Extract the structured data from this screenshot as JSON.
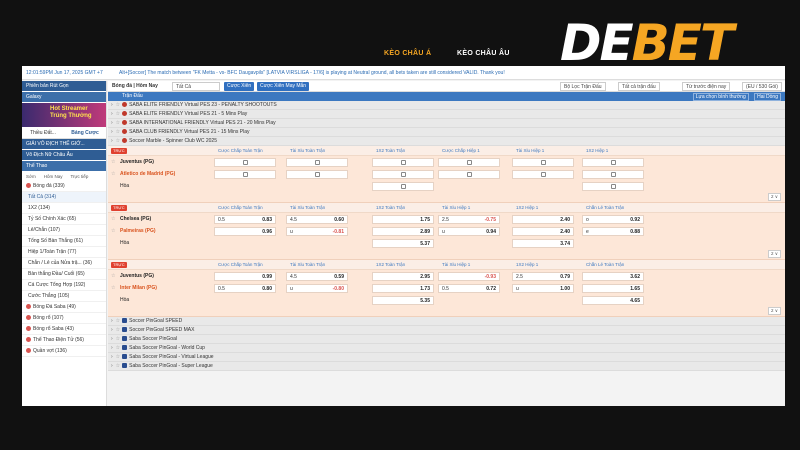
{
  "brand": {
    "logo_de": "DE",
    "logo_bet": "BET"
  },
  "top_tabs": {
    "active": "KÈO CHÂU Á",
    "other": "KÈO CHÂU ÂU"
  },
  "status": {
    "time": "12:01:59PM Jun 17, 2025 GMT +7",
    "message": "Alt+[Soccer] The match between \"FK Metta - vs- BFC Daugavpils\" [LATVIA VIRSLIGA - 17/6] is playing at Neutral ground, all bets taken are still considered VALID. Thank you!"
  },
  "sidebar": {
    "head1": "Phiên bản Rút Gọn",
    "head2": "Galaxy",
    "banner": "Hot Streamer Trúng Thưởng",
    "tabs": [
      "Thiều Đất...",
      "Bảng Cược"
    ],
    "sections": [
      "GIẢI VÔ ĐỊCH THẾ GIỚ...",
      "Vô Địch Nữ Châu Âu",
      "Thể Thao"
    ],
    "subtabs": [
      "Sớm",
      "Hôm Nay",
      "Trực tiếp"
    ],
    "items": [
      {
        "label": "Bóng đá (339)",
        "type": "sport"
      },
      {
        "label": "Tất Cả (314)",
        "type": "sel"
      },
      {
        "label": "1X2 (134)",
        "type": "sub"
      },
      {
        "label": "Tỷ Số Chính Xác (65)",
        "type": "sub"
      },
      {
        "label": "Lẻ/Chẵn (107)",
        "type": "sub"
      },
      {
        "label": "Tổng Số Bàn Thắng (61)",
        "type": "sub"
      },
      {
        "label": "Hiệp 1/Toàn Trận (77)",
        "type": "sub"
      },
      {
        "label": "Chẵn / Lẻ của Nửa trậ... (36)",
        "type": "sub"
      },
      {
        "label": "Bàn thắng Đầu/ Cuối (65)",
        "type": "sub"
      },
      {
        "label": "Cá Cược Tổng Hợp (192)",
        "type": "sub"
      },
      {
        "label": "Cước Thắng (105)",
        "type": "sub"
      },
      {
        "label": "Bóng Đá Saba (49)",
        "type": "sport"
      },
      {
        "label": "Bóng rổ (107)",
        "type": "sport"
      },
      {
        "label": "Bóng rổ Saba (43)",
        "type": "sport"
      },
      {
        "label": "Thể Thao Điện Tử (56)",
        "type": "sport"
      },
      {
        "label": "Quần vợt (136)",
        "type": "sport"
      }
    ]
  },
  "toolbar": {
    "title": "Bóng đá | Hôm Nay",
    "select_all": "Tất Cả",
    "btn_main": "Cược Xiên",
    "btn_xien": "Cược Xiên May Mắn",
    "filter1": "Bộ Lọc Trận Đấu",
    "filter2": "Tất cả trận đấu",
    "filter3": "Từ trước điện nay",
    "odds_type": "(EU / 530 Gói)"
  },
  "bar": {
    "label": "Trận Đấu",
    "right1": "Lựa chọn bình thường",
    "right2": "Hai Dòng"
  },
  "leagues_top": [
    "SABA ELITE FRIENDLY Virtual PES 23 - PENALTY SHOOTOUTS",
    "SABA ELITE FRIENDLY Virtual PES 21 - 5 Mins Play",
    "SABA INTERNATIONAL FRIENDLY Virtual PES 21 - 20 Mins Play",
    "SABA CLUB FRIENDLY Virtual PES 21 - 15 Mins Play",
    "Soccer Marble - Spinner Club WC 2025"
  ],
  "headers_a": [
    "Cược Chấp Toàn Trận",
    "Tài Xỉu Toàn Trận",
    "1X2 Toàn Trận",
    "Cược Chấp Hiệp 1",
    "Tài Xỉu Hiệp 1",
    "1X2 Hiệp 1"
  ],
  "headers_b": [
    "Cược Chấp Toàn Trận",
    "Tài Xỉu Toàn Trận",
    "1X2 Toàn Trận",
    "Tài Xỉu Hiệp 1",
    "1X2 Hiệp 1",
    "Chẵn Lẻ Toàn Trận"
  ],
  "live": "TRỰC",
  "more": "2 ∨",
  "matches": [
    {
      "home": "Juventus (PG)",
      "away": "Atletico de Madrid (PG)",
      "draw": "Hòa",
      "home_score": "1",
      "away_score": "0"
    },
    {
      "home": "Chelsea (PG)",
      "away": "Palmeiras (PG)",
      "draw": "Hòa",
      "home_score": "0",
      "away_score": "0",
      "r1": {
        "h1": "0.5",
        "o1": "0.83",
        "h2": "4.5",
        "o2": "0.60",
        "x": "1.75",
        "h3": "2.5",
        "o3": "-0.75",
        "x2": "2.40",
        "h4": "o",
        "o4": "0.92"
      },
      "r2": {
        "o1": "0.96",
        "h2": "u",
        "o2": "-0.81",
        "x": "2.89",
        "h3": "u",
        "o3": "0.94",
        "x2": "2.40",
        "h4": "e",
        "o4": "0.88"
      },
      "r3": {
        "x": "5.37",
        "x2": "3.74"
      }
    },
    {
      "home": "Juventus (PG)",
      "away": "Inter Milan (PG)",
      "draw": "Hòa",
      "home_score": "0",
      "away_score": "0",
      "r1": {
        "o1": "0.99",
        "h2": "4.5",
        "o2": "0.59",
        "x": "2.95",
        "o3": "-0.93",
        "h4": "2.5",
        "o4": "0.79",
        "x2": "3.62"
      },
      "r2": {
        "h1": "0.5",
        "o1": "0.80",
        "h2": "u",
        "o2": "-0.80",
        "x": "1.73",
        "h3": "0.5",
        "o3": "0.72",
        "h4": "u",
        "o4": "1.00",
        "x2": "1.65"
      },
      "r3": {
        "x": "5.35",
        "x2": "4.65"
      }
    }
  ],
  "leagues_bottom": [
    "Soccer PinGoal SPEED",
    "Soccer PinGoal SPEED MAX",
    "Saba Soccer PinGoal",
    "Saba Soccer PinGoal - World Cup",
    "Saba Soccer PinGoal - Virtual League",
    "Saba Soccer PinGoal - Super League"
  ]
}
